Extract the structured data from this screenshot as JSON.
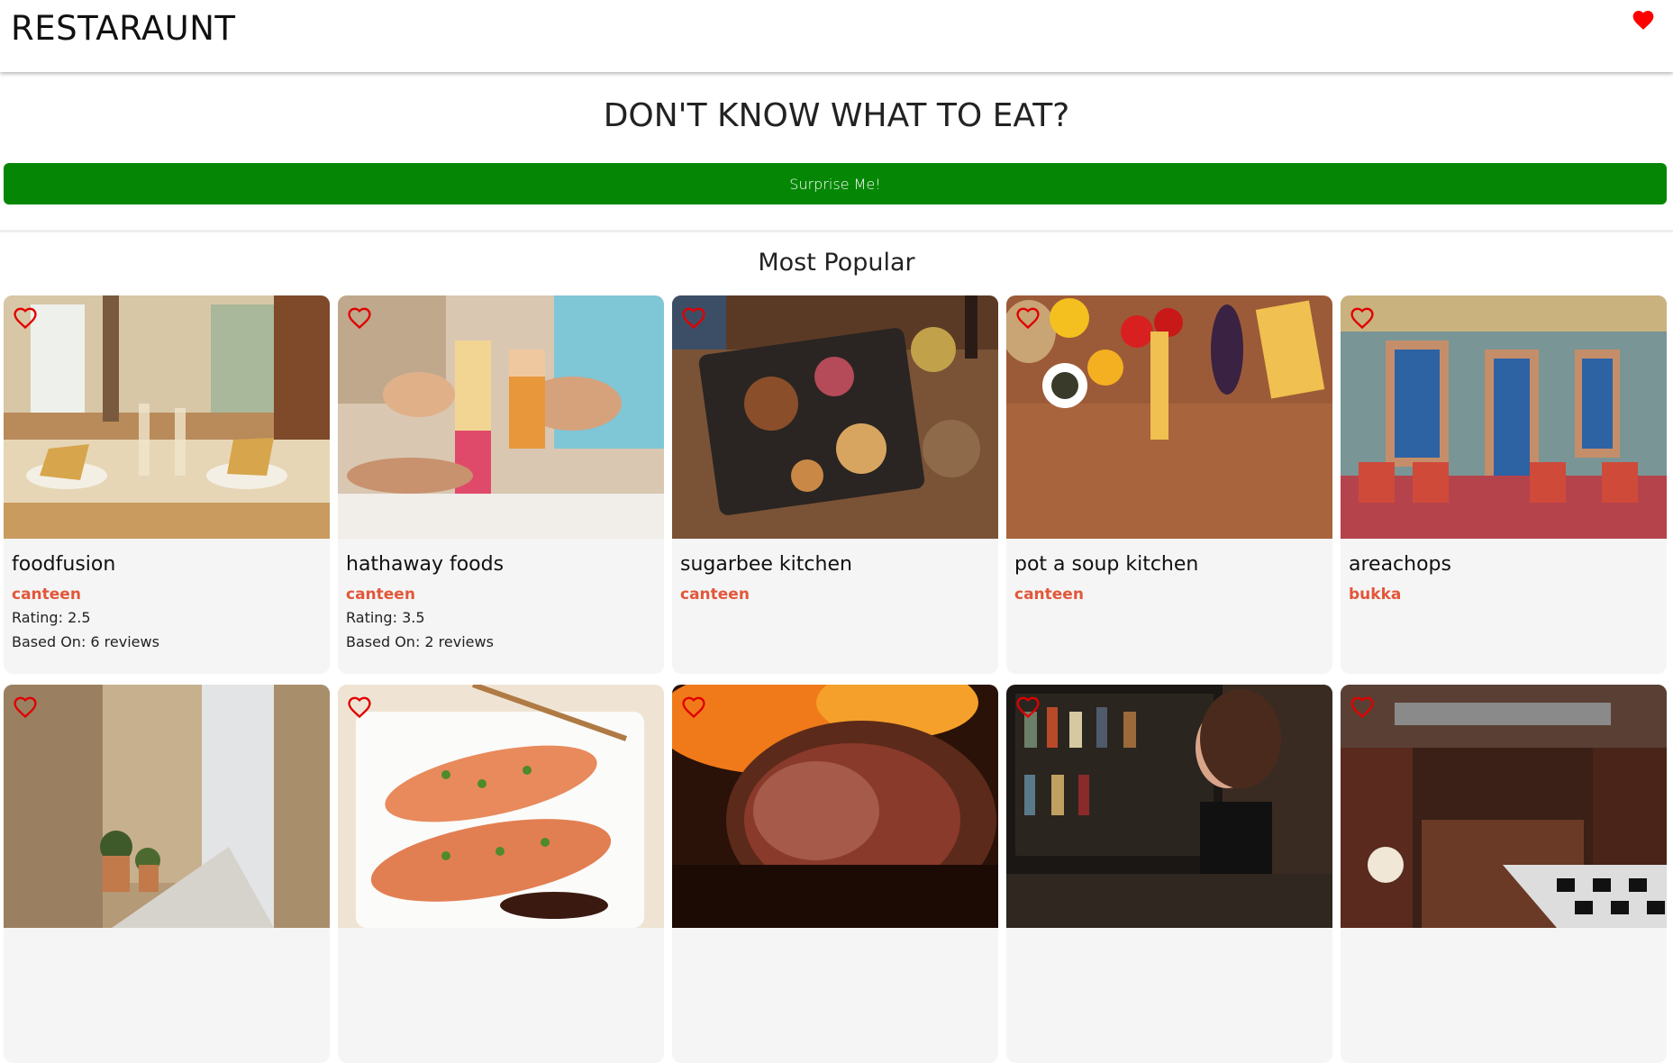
{
  "header": {
    "brand": "RESTARAUNT",
    "favorites_icon": "heart-filled-icon",
    "heart_color": "#ff0000"
  },
  "hero": {
    "title": "DON'T KNOW WHAT TO EAT?",
    "button_label": "Surprise Me!",
    "button_color": "#058705"
  },
  "section": {
    "title": "Most Popular"
  },
  "colors": {
    "category": "#e2573a",
    "card_bg": "#f5f5f5"
  },
  "restaurants": [
    {
      "name": "foodfusion",
      "category": "canteen",
      "rating": "Rating: 2.5",
      "reviews": "Based On: 6 reviews"
    },
    {
      "name": "hathaway foods",
      "category": "canteen",
      "rating": "Rating: 3.5",
      "reviews": "Based On: 2 reviews"
    },
    {
      "name": "sugarbee kitchen",
      "category": "canteen"
    },
    {
      "name": "pot a soup kitchen",
      "category": "canteen"
    },
    {
      "name": "areachops",
      "category": "bukka"
    },
    {
      "name": "",
      "category": ""
    },
    {
      "name": "",
      "category": ""
    },
    {
      "name": "",
      "category": ""
    },
    {
      "name": "",
      "category": ""
    },
    {
      "name": "",
      "category": ""
    }
  ]
}
